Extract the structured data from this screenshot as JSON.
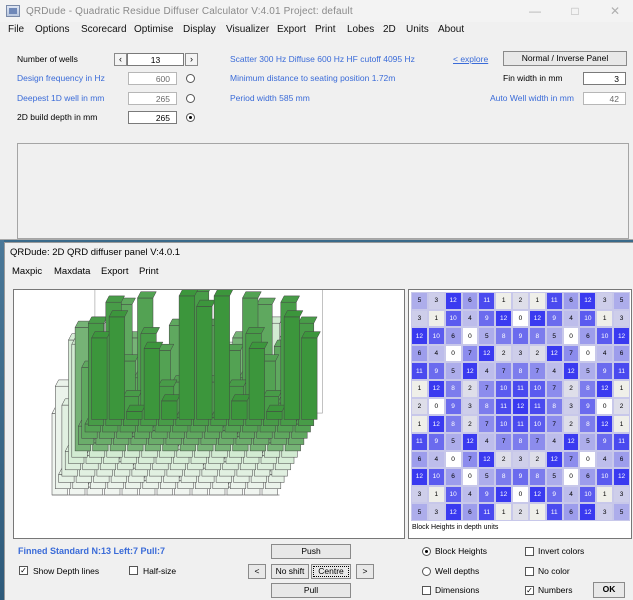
{
  "window": {
    "title": "QRDude  -  Quadratic Residue Diffuser Calculator    V:4.01    Project: default"
  },
  "menu": [
    "File",
    "Options",
    "Scorecard",
    "Optimise",
    "Display",
    "Visualizer",
    "Export",
    "Print",
    "Lobes",
    "2D",
    "Units",
    "About"
  ],
  "params": {
    "wells_label": "Number of wells",
    "wells_value": "13",
    "freq_label": "Design frequency in Hz",
    "freq_value": "600",
    "deep_label": "Deepest 1D well in mm",
    "deep_value": "265",
    "build_label": "2D build depth in mm",
    "build_value": "265",
    "scatter": "Scatter 300 Hz   Diffuse 600 Hz   HF cutoff 4095 Hz",
    "explore": "< explore",
    "panel_button": "Normal / Inverse Panel",
    "min_distance": "Minimum distance to seating position  1.72m",
    "period": "Period width  585 mm",
    "fin_label": "Fin width in mm",
    "fin_value": "3",
    "auto_label": "Auto Well width in mm",
    "auto_value": "42"
  },
  "panel": {
    "title": "QRDude: 2D QRD diffuser panel    V:4.0.1",
    "menu": [
      "Maxpic",
      "Maxdata",
      "Export",
      "Print"
    ],
    "grid_caption": "Block Heights in depth units",
    "grid": [
      [
        5,
        3,
        12,
        6,
        11,
        1,
        2,
        1,
        11,
        6,
        12,
        3,
        5
      ],
      [
        3,
        1,
        10,
        4,
        9,
        12,
        0,
        12,
        9,
        4,
        10,
        1,
        3
      ],
      [
        12,
        10,
        6,
        0,
        5,
        8,
        9,
        8,
        5,
        0,
        6,
        10,
        12
      ],
      [
        6,
        4,
        0,
        7,
        12,
        2,
        3,
        2,
        12,
        7,
        0,
        4,
        6
      ],
      [
        11,
        9,
        5,
        12,
        4,
        7,
        8,
        7,
        4,
        12,
        5,
        9,
        11
      ],
      [
        1,
        12,
        8,
        2,
        7,
        10,
        11,
        10,
        7,
        2,
        8,
        12,
        1
      ],
      [
        2,
        0,
        9,
        3,
        8,
        11,
        12,
        11,
        8,
        3,
        9,
        0,
        2
      ],
      [
        1,
        12,
        8,
        2,
        7,
        10,
        11,
        10,
        7,
        2,
        8,
        12,
        1
      ],
      [
        11,
        9,
        5,
        12,
        4,
        7,
        8,
        7,
        4,
        12,
        5,
        9,
        11
      ],
      [
        6,
        4,
        0,
        7,
        12,
        2,
        3,
        2,
        12,
        7,
        0,
        4,
        6
      ],
      [
        12,
        10,
        6,
        0,
        5,
        8,
        9,
        8,
        5,
        0,
        6,
        10,
        12
      ],
      [
        3,
        1,
        10,
        4,
        9,
        12,
        0,
        12,
        9,
        4,
        10,
        1,
        3
      ],
      [
        5,
        3,
        12,
        6,
        11,
        1,
        2,
        1,
        11,
        6,
        12,
        3,
        5
      ]
    ],
    "status": "Finned Standard    N:13  Left:7  Pull:7",
    "show_depth_lines": "Show Depth lines",
    "half_size": "Half-size",
    "push": "Push",
    "no_shift": "No shift",
    "centre": "Centre",
    "pull": "Pull",
    "prev": "<",
    "next": ">",
    "block_heights": "Block Heights",
    "well_depths": "Well depths",
    "dimensions": "Dimensions",
    "invert_colors": "Invert colors",
    "no_color": "No color",
    "numbers": "Numbers",
    "ok": "OK"
  },
  "colors": {
    "accent": "#3a6bd8",
    "green": "#3e9a3e",
    "grid_hi": "#3a3ad8"
  }
}
